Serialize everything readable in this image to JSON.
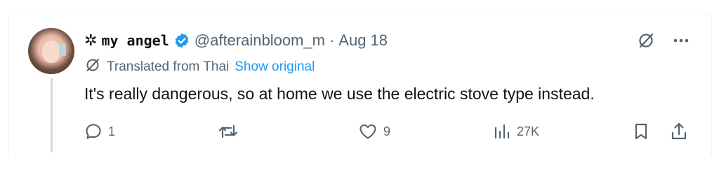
{
  "post": {
    "author": {
      "name_prefix": "✲",
      "display_name": "my angel",
      "handle": "@afterainbloom_m",
      "verified": true
    },
    "separator": "·",
    "date": "Aug 18",
    "translation": {
      "label": "Translated from Thai",
      "show_original": "Show original"
    },
    "text": "It's really dangerous, so at home we use the electric stove type instead.",
    "stats": {
      "replies": "1",
      "reposts": "",
      "likes": "9",
      "views": "27K"
    }
  },
  "colors": {
    "text": "#0f1419",
    "muted": "#536471",
    "accent": "#1d9bf0",
    "thread_line": "#cfd9de"
  },
  "icons": [
    "grok-icon",
    "more-icon",
    "translate-icon",
    "reply-icon",
    "repost-icon",
    "like-icon",
    "views-icon",
    "bookmark-icon",
    "share-icon"
  ]
}
